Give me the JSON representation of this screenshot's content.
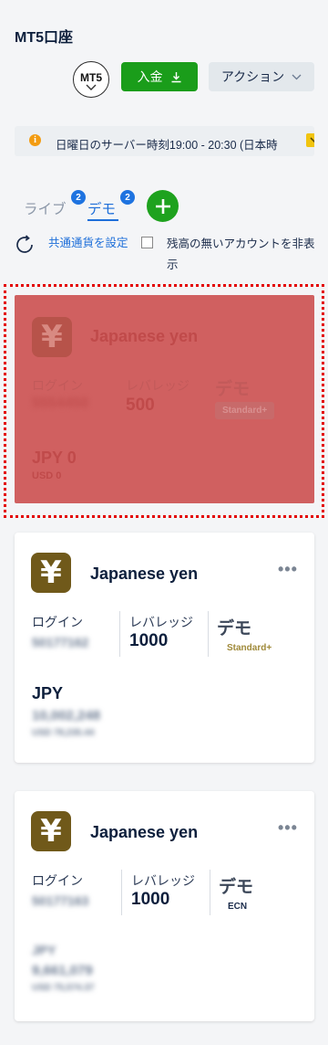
{
  "header": {
    "title": "MT5口座",
    "platform_badge": "MT5",
    "deposit_label": "入金",
    "action_label": "アクション"
  },
  "notice": {
    "icon": "info-icon",
    "text": "日曜日のサーバー時刻19:00 - 20:30 (日本時"
  },
  "tabs": [
    {
      "label": "ライブ",
      "count": "2",
      "active": false
    },
    {
      "label": "デモ",
      "count": "2",
      "active": true
    }
  ],
  "controls": {
    "set_currency_label": "共通通貨を設定",
    "hide_zero_label": "残高の無いアカウントを非表示"
  },
  "accounts": [
    {
      "currency_symbol": "¥",
      "name": "Japanese yen",
      "login_label": "ログイン",
      "login_value": "5554450",
      "leverage_label": "レバレッジ",
      "leverage_value": "500",
      "account_type": "デモ",
      "sub_type": "Standard+",
      "balance_currency": "JPY 0",
      "converted": "USD 0",
      "selected": true
    },
    {
      "currency_symbol": "¥",
      "name": "Japanese yen",
      "login_label": "ログイン",
      "login_value": "50177162",
      "leverage_label": "レバレッジ",
      "leverage_value": "1000",
      "account_type": "デモ",
      "sub_type": "Standard+",
      "balance_currency": "JPY",
      "balance_value": "10,002,248",
      "converted": "USD 78,235.44"
    },
    {
      "currency_symbol": "¥",
      "name": "Japanese yen",
      "login_label": "ログイン",
      "login_value": "50177163",
      "leverage_label": "レバレッジ",
      "leverage_value": "1000",
      "account_type": "デモ",
      "sub_type": "ECN",
      "balance_currency": "JPY",
      "balance_value": "9,661,079",
      "converted": "USD 75,574.37"
    }
  ],
  "colors": {
    "accent_blue": "#1e6fd9",
    "deposit_green": "#1a9d1a",
    "yen_badge": "#70591a",
    "selection_outline": "#e30000"
  }
}
